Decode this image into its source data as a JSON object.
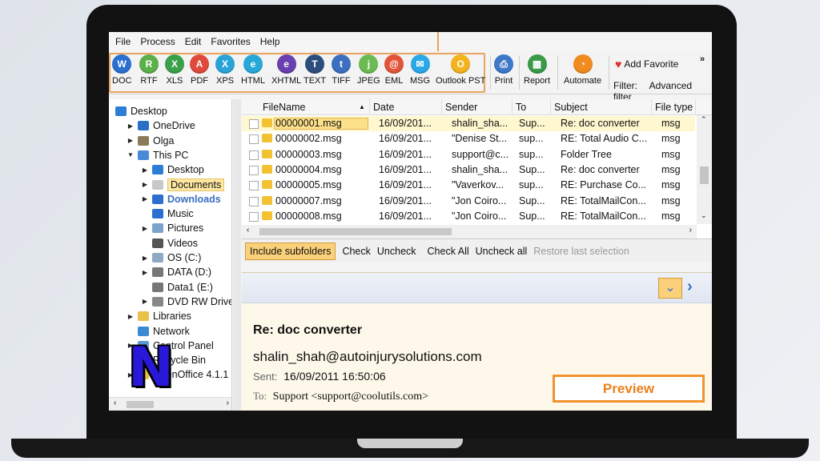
{
  "menu": [
    "File",
    "Process",
    "Edit",
    "Favorites",
    "Help"
  ],
  "formats": [
    {
      "label": "DOC",
      "icon": "doc-icon",
      "color": "#2b6fd0",
      "glyph": "W"
    },
    {
      "label": "RTF",
      "icon": "rtf-icon",
      "color": "#5bb04a",
      "glyph": "R"
    },
    {
      "label": "XLS",
      "icon": "xls-icon",
      "color": "#3aa14a",
      "glyph": "X"
    },
    {
      "label": "PDF",
      "icon": "pdf-icon",
      "color": "#e04a3c",
      "glyph": "A"
    },
    {
      "label": "XPS",
      "icon": "xps-icon",
      "color": "#2aa3d8",
      "glyph": "X"
    },
    {
      "label": "HTML",
      "icon": "html-icon",
      "color": "#27a8d8",
      "glyph": "e"
    },
    {
      "label": "XHTML",
      "icon": "xhtml-icon",
      "color": "#6a3fb0",
      "glyph": "e"
    },
    {
      "label": "TEXT",
      "icon": "text-icon",
      "color": "#2c4e7e",
      "glyph": "T"
    },
    {
      "label": "TIFF",
      "icon": "tiff-icon",
      "color": "#3b6fbf",
      "glyph": "t"
    },
    {
      "label": "JPEG",
      "icon": "jpeg-icon",
      "color": "#6bbb52",
      "glyph": "j"
    },
    {
      "label": "EML",
      "icon": "eml-icon",
      "color": "#e2543a",
      "glyph": "@"
    },
    {
      "label": "MSG",
      "icon": "msg-icon",
      "color": "#2ba8e8",
      "glyph": "✉"
    },
    {
      "label": "Outlook PST",
      "icon": "outlook-pst-icon",
      "color": "#f2b31d",
      "glyph": "O"
    }
  ],
  "tools": [
    {
      "label": "Print",
      "icon": "print-icon",
      "color": "#3d78c9",
      "glyph": "⎙"
    },
    {
      "label": "Report",
      "icon": "report-icon",
      "color": "#3a9a4a",
      "glyph": "▦"
    },
    {
      "label": "Automate",
      "icon": "automate-icon",
      "color": "#f08b1f",
      "glyph": "◔"
    }
  ],
  "add_favorite": "Add Favorite",
  "filter_label": "Filter:",
  "advanced_filter": "Advanced filter",
  "more": "»",
  "tree": [
    {
      "label": "Desktop",
      "indent": 0,
      "arrow": "",
      "icon": "desktop-icon",
      "color": "#2c7dd6"
    },
    {
      "label": "OneDrive",
      "indent": 1,
      "arrow": "▶",
      "icon": "onedrive-icon",
      "color": "#2a6fc4"
    },
    {
      "label": "Olga",
      "indent": 1,
      "arrow": "▶",
      "icon": "user-icon",
      "color": "#8a7a5a"
    },
    {
      "label": "This PC",
      "indent": 1,
      "arrow": "▼",
      "icon": "computer-icon",
      "color": "#4a8ad6"
    },
    {
      "label": "Desktop",
      "indent": 2,
      "arrow": "▶",
      "icon": "desktop-icon",
      "color": "#2c7dd6"
    },
    {
      "label": "Documents",
      "indent": 2,
      "arrow": "▶",
      "icon": "documents-icon",
      "color": "#c8c8c8",
      "highlight": true
    },
    {
      "label": "Downloads",
      "indent": 2,
      "arrow": "▶",
      "icon": "downloads-icon",
      "color": "#2c6fd0",
      "dl": true
    },
    {
      "label": "Music",
      "indent": 2,
      "arrow": "",
      "icon": "music-icon",
      "color": "#2c6fd0"
    },
    {
      "label": "Pictures",
      "indent": 2,
      "arrow": "▶",
      "icon": "pictures-icon",
      "color": "#7aa3cc"
    },
    {
      "label": "Videos",
      "indent": 2,
      "arrow": "",
      "icon": "videos-icon",
      "color": "#555"
    },
    {
      "label": "OS (C:)",
      "indent": 2,
      "arrow": "▶",
      "icon": "drive-icon",
      "color": "#8fa8c4"
    },
    {
      "label": "DATA (D:)",
      "indent": 2,
      "arrow": "▶",
      "icon": "drive-icon",
      "color": "#777"
    },
    {
      "label": "Data1 (E:)",
      "indent": 2,
      "arrow": "",
      "icon": "drive-icon",
      "color": "#777"
    },
    {
      "label": "DVD RW Drive (",
      "indent": 2,
      "arrow": "▶",
      "icon": "dvd-icon",
      "color": "#888"
    },
    {
      "label": "Libraries",
      "indent": 1,
      "arrow": "▶",
      "icon": "libraries-icon",
      "color": "#e8c04a"
    },
    {
      "label": "Network",
      "indent": 1,
      "arrow": "",
      "icon": "network-icon",
      "color": "#3a8ad6"
    },
    {
      "label": "Control Panel",
      "indent": 1,
      "arrow": "▶",
      "icon": "control-panel-icon",
      "color": "#5a9ad6"
    },
    {
      "label": "Recycle Bin",
      "indent": 1,
      "arrow": "",
      "icon": "recycle-bin-icon",
      "color": "#7aa3cc"
    },
    {
      "label": "OpenOffice 4.1.1 L",
      "indent": 1,
      "arrow": "▶",
      "icon": "folder-icon",
      "color": "#e8c04a"
    }
  ],
  "columns": [
    "FileName",
    "Date",
    "Sender",
    "To",
    "Subject",
    "File type"
  ],
  "sort_indicator": "▲",
  "rows": [
    [
      "00000001.msg",
      "16/09/201...",
      "shalin_sha...",
      "Sup...",
      "Re: doc converter",
      "msg"
    ],
    [
      "00000002.msg",
      "16/09/201...",
      "\"Denise St...",
      "sup...",
      "RE: Total Audio C...",
      "msg"
    ],
    [
      "00000003.msg",
      "16/09/201...",
      "support@c...",
      "sup...",
      "Folder Tree",
      "msg"
    ],
    [
      "00000004.msg",
      "16/09/201...",
      "shalin_sha...",
      "Sup...",
      "Re: doc converter",
      "msg"
    ],
    [
      "00000005.msg",
      "16/09/201...",
      "\"Vaverkov...",
      "sup...",
      "RE: Purchase Co...",
      "msg"
    ],
    [
      "00000007.msg",
      "16/09/201...",
      "\"Jon Coiro...",
      "Sup...",
      "RE: TotalMailCon...",
      "msg"
    ],
    [
      "00000008.msg",
      "16/09/201...",
      "\"Jon Coiro...",
      "Sup...",
      "RE: TotalMailCon...",
      "msg"
    ]
  ],
  "actions": {
    "include_subfolders": "Include subfolders",
    "check": "Check",
    "uncheck": "Uncheck",
    "check_all": "Check All",
    "uncheck_all": "Uncheck all",
    "restore": "Restore last selection"
  },
  "preview": {
    "subject": "Re: doc converter",
    "sender": "shalin_shah@autoinjurysolutions.com",
    "sent_label": "Sent:",
    "sent_value": "16/09/2011 16:50:06",
    "to_label": "To:",
    "to_value": "Support <support@coolutils.com>",
    "button": "Preview"
  },
  "logo_letter": "N"
}
